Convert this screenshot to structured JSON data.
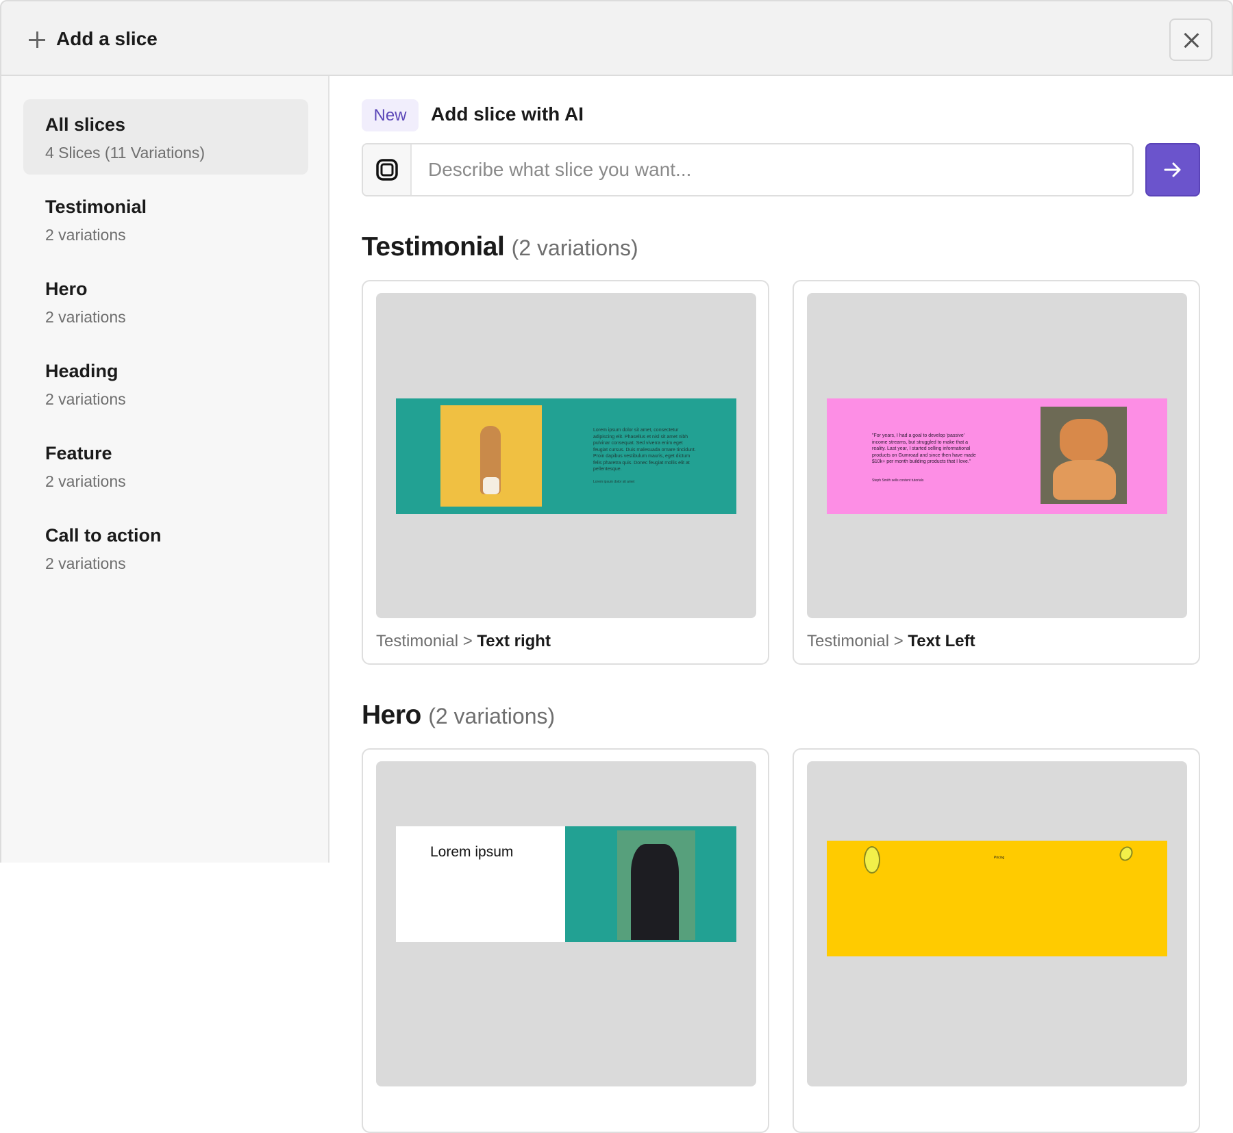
{
  "header": {
    "title": "Add a slice",
    "close_label": "Close"
  },
  "sidebar": {
    "items": [
      {
        "title": "All slices",
        "subtitle": "4 Slices (11 Variations)"
      },
      {
        "title": "Testimonial",
        "subtitle": "2 variations"
      },
      {
        "title": "Hero",
        "subtitle": "2 variations"
      },
      {
        "title": "Heading",
        "subtitle": "2 variations"
      },
      {
        "title": "Feature",
        "subtitle": "2 variations"
      },
      {
        "title": "Call to action",
        "subtitle": "2 variations"
      }
    ]
  },
  "ai": {
    "badge": "New",
    "title": "Add slice with AI",
    "placeholder": "Describe what slice you want..."
  },
  "sections": [
    {
      "title": "Testimonial",
      "count": "(2 variations)",
      "cards": [
        {
          "slice": "Testimonial",
          "sep": ">",
          "variation": "Text right",
          "body": "Lorem ipsum dolor sit amet, consectetur adipiscing elit. Phasellus et nisl sit amet nibh pulvinar consequat. Sed viverra enim eget feugiat cursus. Duis malesuada ornare tincidunt. Proin dapibus vestibulum mauris, eget dictum felis pharetra quis. Donec feugiat mollis elit at pellentesque.",
          "author": "Lorem ipsum dolor sit amet"
        },
        {
          "slice": "Testimonial",
          "sep": ">",
          "variation": "Text Left",
          "body": "\"For years, I had a goal to develop 'passive' income streams, but struggled to make that a reality. Last year, I started selling informational products on Gumroad and since then have made $10k+ per month building products that I love.\"",
          "author": "Steph Smith sells content tutorials"
        }
      ]
    },
    {
      "title": "Hero",
      "count": "(2 variations)",
      "cards": [
        {
          "heading": "Lorem ipsum"
        },
        {
          "label": "Pricing"
        }
      ]
    }
  ],
  "colors": {
    "accent": "#6b54cc",
    "teal": "#22a193",
    "pink": "#fd8ee5",
    "yellow": "#ffcb00"
  }
}
